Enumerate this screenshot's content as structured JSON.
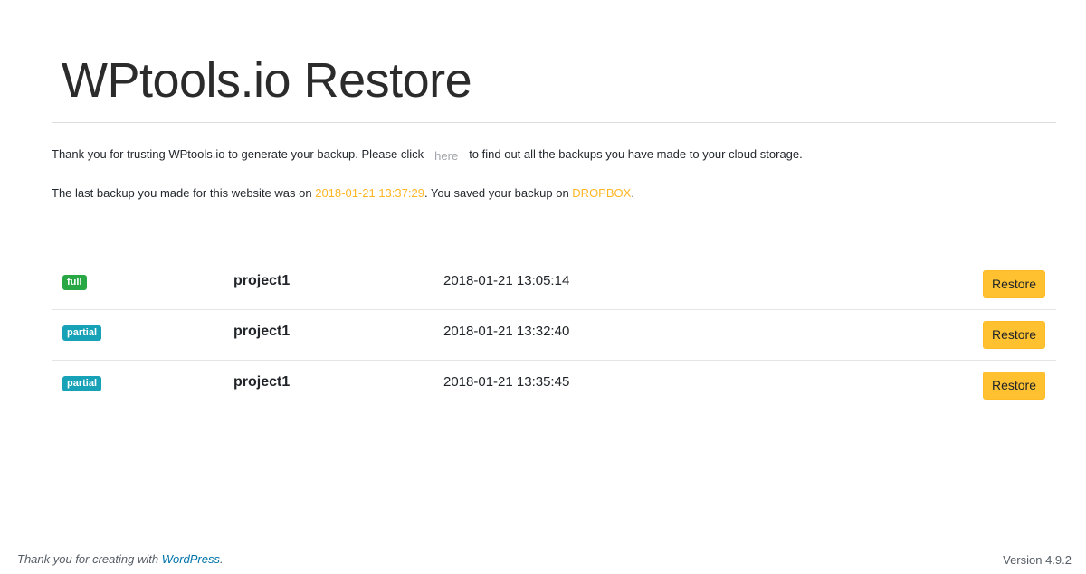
{
  "page": {
    "title": "WPtools.io Restore",
    "intro": {
      "before_link": "Thank you for trusting WPtools.io to generate your backup. Please click",
      "link_text": "here",
      "after_link": "to find out all the backups you have made to your cloud storage."
    },
    "last_backup": {
      "prefix": "The last backup you made for this website was on",
      "date": "2018-01-21 13:37:29",
      "middle": ". You saved your backup on",
      "storage": "DROPBOX",
      "suffix": "."
    }
  },
  "backups": [
    {
      "type": "full",
      "project": "project1",
      "date": "2018-01-21 13:05:14",
      "action": "Restore"
    },
    {
      "type": "partial",
      "project": "project1",
      "date": "2018-01-21 13:32:40",
      "action": "Restore"
    },
    {
      "type": "partial",
      "project": "project1",
      "date": "2018-01-21 13:35:45",
      "action": "Restore"
    }
  ],
  "footer": {
    "thanks_prefix": "Thank you for creating with",
    "wordpress_link": "WordPress",
    "thanks_suffix": ".",
    "version": "Version 4.9.2"
  },
  "colors": {
    "accent": "#ffb625",
    "badge_full": "#28a745",
    "badge_partial": "#17a2b8",
    "restore_button": "#ffc130",
    "link": "#0073aa"
  }
}
